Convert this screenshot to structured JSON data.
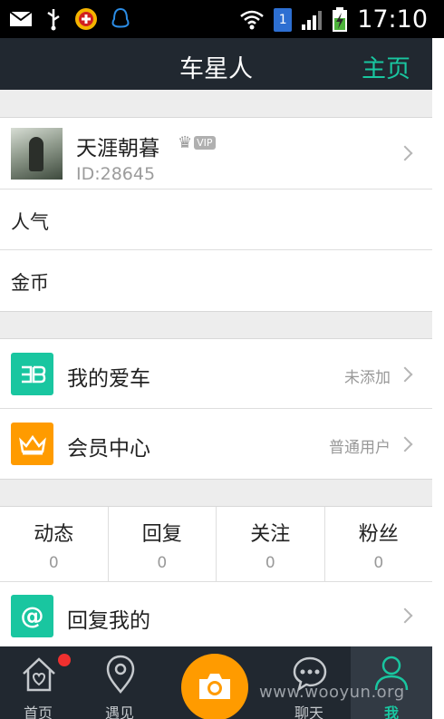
{
  "status_bar": {
    "time": "17:10",
    "sim_slot": "1",
    "icons": [
      "mail-icon",
      "usb-icon",
      "app-notification-icon",
      "qq-icon",
      "wifi-icon",
      "signal-icon",
      "battery-charging-icon"
    ]
  },
  "header": {
    "title": "车星人",
    "home_label": "主页"
  },
  "profile": {
    "name": "天涯朝暮",
    "vip_label": "VIP",
    "id_text": "ID:28645"
  },
  "stats_plain": [
    {
      "label": "人气"
    },
    {
      "label": "金币"
    }
  ],
  "menu": [
    {
      "label": "我的爱车",
      "value": "未添加",
      "icon": "car-logo-icon",
      "color": "#19c6a0"
    },
    {
      "label": "会员中心",
      "value": "普通用户",
      "icon": "crown-icon",
      "color": "#ff9b00"
    }
  ],
  "social_stats": [
    {
      "label": "动态",
      "count": "0"
    },
    {
      "label": "回复",
      "count": "0"
    },
    {
      "label": "关注",
      "count": "0"
    },
    {
      "label": "粉丝",
      "count": "0"
    }
  ],
  "replies": {
    "label": "回复我的",
    "icon": "at-icon",
    "color": "#19c6a0"
  },
  "tabbar": {
    "tabs": [
      {
        "label": "首页",
        "icon": "home-icon"
      },
      {
        "label": "遇见",
        "icon": "location-pin-icon"
      },
      {
        "label": "",
        "icon": "camera-icon"
      },
      {
        "label": "聊天",
        "icon": "chat-bubble-icon"
      },
      {
        "label": "我",
        "icon": "person-icon"
      }
    ],
    "active": "我",
    "accent": "#19c6a0",
    "camera_color": "#ff9b00"
  },
  "watermark": "www.wooyun.org"
}
